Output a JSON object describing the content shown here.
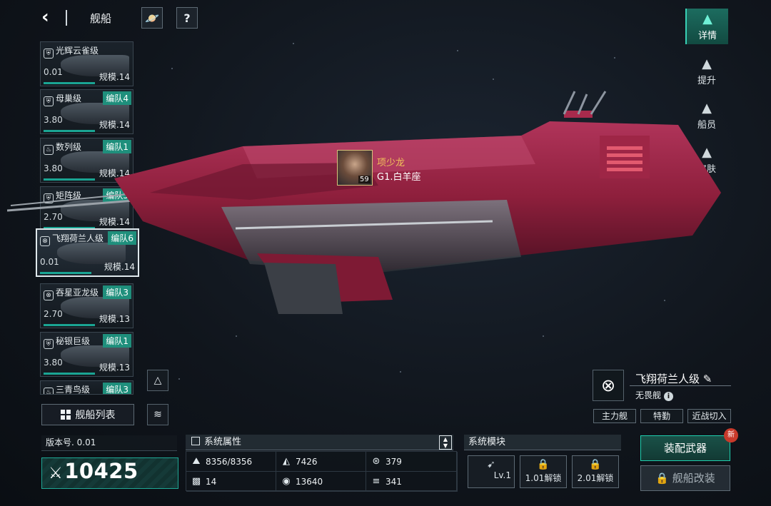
{
  "header": {
    "title": "舰船",
    "back_icon": "chevron-left-icon"
  },
  "ships": [
    {
      "class": "光辉云雀级",
      "fleet": "",
      "version": "0.01",
      "scale": "规模.14",
      "icon": "shield-icon"
    },
    {
      "class": "母巢级",
      "fleet": "编队4",
      "version": "3.80",
      "scale": "规模.14",
      "icon": "shield-icon"
    },
    {
      "class": "数列级",
      "fleet": "编队1",
      "version": "3.80",
      "scale": "规模.14",
      "icon": "flame-icon"
    },
    {
      "class": "矩阵级",
      "fleet": "编队5",
      "version": "2.70",
      "scale": "规模.14",
      "icon": "shield-icon"
    },
    {
      "class": "飞翔荷兰人级",
      "fleet": "编队6",
      "version": "0.01",
      "scale": "规模.14",
      "icon": "crosshair-icon"
    },
    {
      "class": "吞星亚龙级",
      "fleet": "编队3",
      "version": "2.70",
      "scale": "规模.13",
      "icon": "crosshair-icon"
    },
    {
      "class": "秘银巨级",
      "fleet": "编队1",
      "version": "3.80",
      "scale": "规模.13",
      "icon": "shield-icon"
    },
    {
      "class": "三青鸟级",
      "fleet": "编队3",
      "version": "",
      "scale": "",
      "icon": "flame-icon"
    }
  ],
  "ship_list_button": "舰船列表",
  "tabs": [
    {
      "label": "详情",
      "active": true
    },
    {
      "label": "提升",
      "active": false
    },
    {
      "label": "船员",
      "active": false
    },
    {
      "label": "皮肤",
      "active": false
    }
  ],
  "pilot": {
    "name": "项少龙",
    "title": "G1.白羊座",
    "level": "59"
  },
  "ship_info": {
    "name": "飞翔荷兰人级",
    "type": "无畏舰",
    "tags": [
      "主力舰",
      "特勤",
      "近战切入"
    ]
  },
  "version_label": "版本号. 0.01",
  "power": "10425",
  "attributes": {
    "title": "系统属性",
    "items": [
      {
        "icon": "hp-icon",
        "value": "8356/8356"
      },
      {
        "icon": "armor-icon",
        "value": "7426"
      },
      {
        "icon": "shield-round-icon",
        "value": "379"
      },
      {
        "icon": "checker-icon",
        "value": "14"
      },
      {
        "icon": "target-icon",
        "value": "13640"
      },
      {
        "icon": "speed-icon",
        "value": "341"
      }
    ]
  },
  "modules": {
    "title": "系统模块",
    "items": [
      {
        "label": "Lv.1",
        "locked": false
      },
      {
        "label": "1.01解锁",
        "locked": true
      },
      {
        "label": "2.01解锁",
        "locked": true
      }
    ]
  },
  "buttons": {
    "equip": "装配武器",
    "new_badge": "新",
    "modify": "舰船改装"
  },
  "colors": {
    "accent": "#1fa895",
    "fleet_tag": "#1f8f7c",
    "pilot_name": "#f0c15a",
    "ship_hull": "#8e1f3c"
  }
}
